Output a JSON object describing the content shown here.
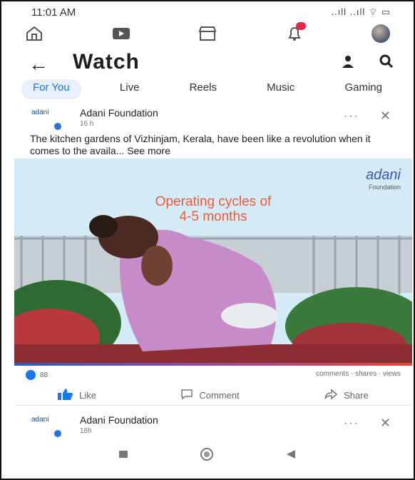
{
  "status_bar": {
    "time": "11:01 AM",
    "right": "..ıll ..ıll ⌔ ▭"
  },
  "nav": [
    "home-icon",
    "video-icon",
    "marketplace-icon",
    "notifications-icon",
    "profile-avatar"
  ],
  "header": {
    "back": "←",
    "title": "Watch"
  },
  "tabs": [
    {
      "label": "For You",
      "active": true
    },
    {
      "label": "Live"
    },
    {
      "label": "Reels"
    },
    {
      "label": "Music"
    },
    {
      "label": "Gaming"
    }
  ],
  "post": {
    "logo_text": "adani",
    "author": "Adani Foundation",
    "time": "16 h",
    "caption": "The kitchen gardens of Vizhinjam, Kerala, have been like a revolution when it comes to the availa...",
    "see_more": "See more",
    "media": {
      "brand": "adani",
      "brand_sub": "Foundation",
      "headline_line1": "Operating cycles of",
      "headline_line2": "4-5 months"
    },
    "reactions": "88",
    "stats_right": "comments · shares · views",
    "actions": {
      "like": "Like",
      "comment": "Comment",
      "share": "Share"
    }
  },
  "post2": {
    "author": "Adani Foundation",
    "time": "18h"
  },
  "colors": {
    "accent": "#1877f2",
    "headline": "#f05a3c",
    "brand": "#3c55b5"
  }
}
